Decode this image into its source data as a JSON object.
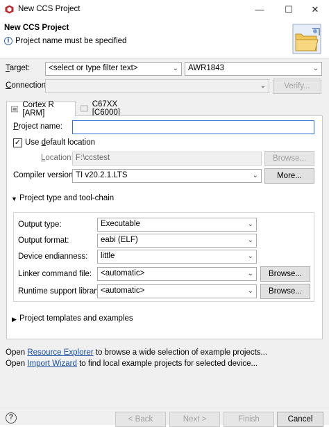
{
  "window": {
    "title": "New CCS Project",
    "minimize": "—",
    "maximize": "☐",
    "close": "✕"
  },
  "header": {
    "title": "New CCS Project",
    "message": "Project name must be specified",
    "info_glyph": "i"
  },
  "target": {
    "label_pre": "",
    "label_u": "T",
    "label_post": "arget:",
    "filter_placeholder": "<select or type filter text>",
    "device": "AWR1843"
  },
  "connection": {
    "label_pre": "",
    "label_u": "C",
    "label_post": "onnection:",
    "value": "",
    "verify_label": "Verify..."
  },
  "tabs": [
    {
      "label": "Cortex R [ARM]",
      "active": true
    },
    {
      "label": "C67XX [C6000]",
      "active": false
    }
  ],
  "project": {
    "name_label_pre": "",
    "name_label_u": "P",
    "name_label_post": "roject name:",
    "name_value": "",
    "use_default_pre": "Use ",
    "use_default_u": "d",
    "use_default_post": "efault location",
    "use_default_checked": "✓",
    "location_label_pre": "",
    "location_label_u": "L",
    "location_label_post": "ocation:",
    "location_value": "F:\\ccstest",
    "browse_label": "Browse...",
    "compiler_label": "Compiler version:",
    "compiler_value": "TI v20.2.1.LTS",
    "more_label": "More..."
  },
  "toolchain": {
    "section_label": "Project type and tool-chain",
    "rows": [
      {
        "label": "Output type:",
        "value": "Executable"
      },
      {
        "label": "Output format:",
        "value": "eabi (ELF)"
      },
      {
        "label": "Device endianness:",
        "value": "little"
      },
      {
        "label": "Linker command file:",
        "value": "<automatic>",
        "button": "Browse..."
      },
      {
        "label": "Runtime support library:",
        "value": "<automatic>",
        "button": "Browse..."
      }
    ]
  },
  "templates": {
    "section_label": "Project templates and examples"
  },
  "footer_links": {
    "line1_pre": "Open ",
    "line1_link": "Resource Explorer",
    "line1_post": " to browse a wide selection of example projects...",
    "line2_pre": "Open ",
    "line2_link": "Import Wizard",
    "line2_post": " to find local example projects for selected device..."
  },
  "buttons": {
    "help": "?",
    "back": "< Back",
    "next": "Next >",
    "finish": "Finish",
    "cancel": "Cancel"
  },
  "icons": {
    "dropdown": "chevron-down-icon",
    "expanded": "triangle-down-icon",
    "collapsed": "triangle-right-icon"
  }
}
